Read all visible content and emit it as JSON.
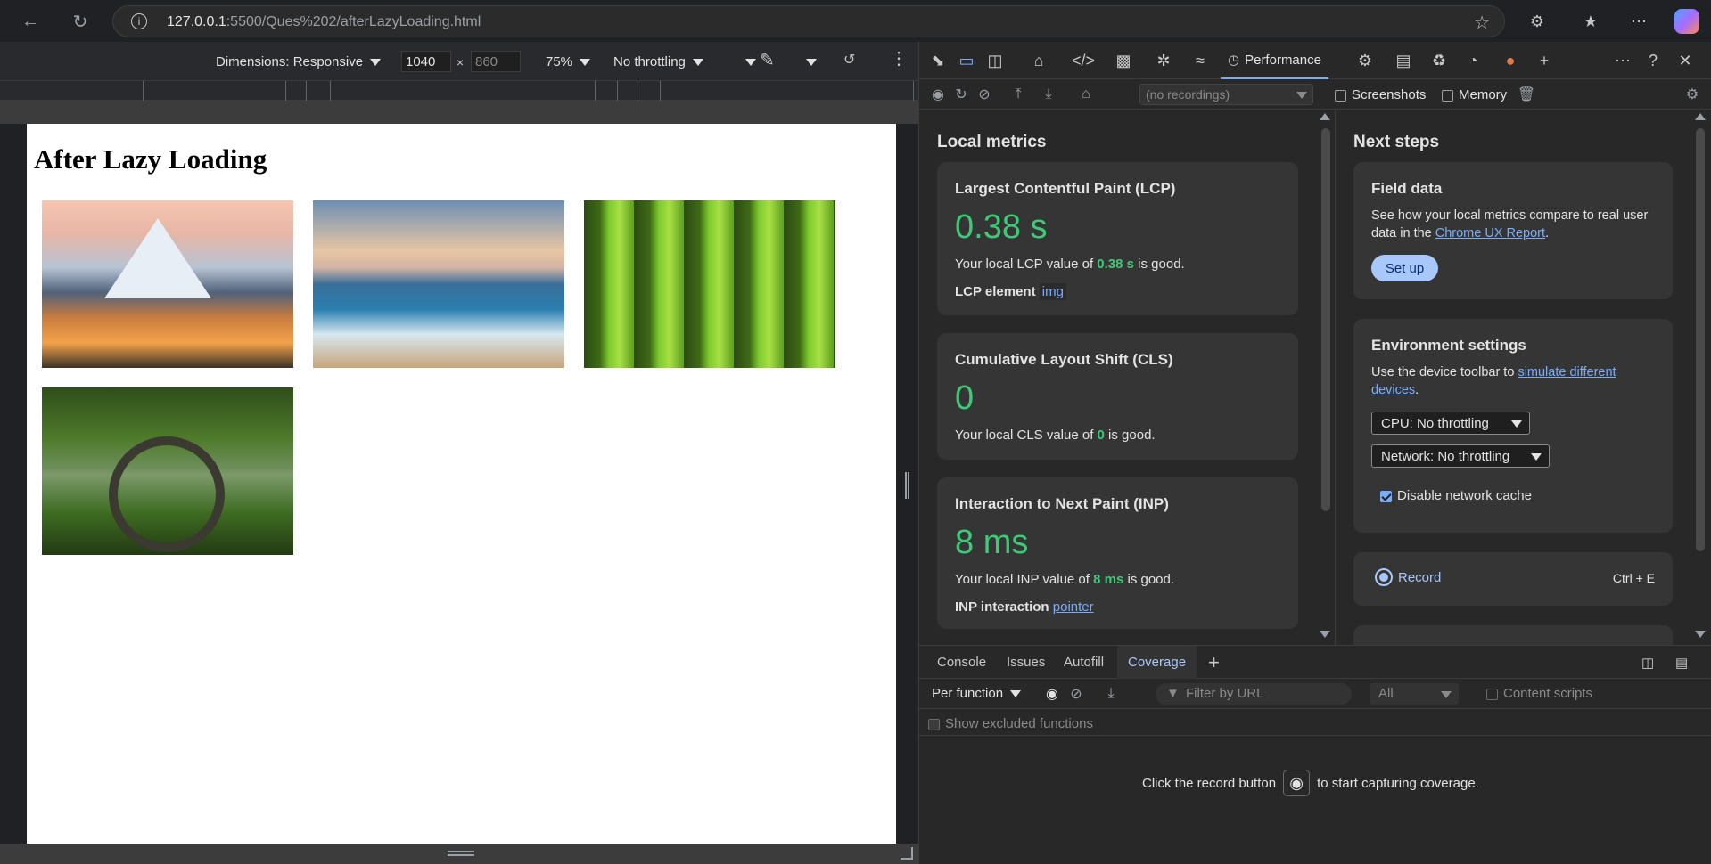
{
  "browser": {
    "url_host": "127.0.0.1",
    "url_rest": ":5500/Ques%202/afterLazyLoading.html"
  },
  "device_toolbar": {
    "dimensions_label": "Dimensions: Responsive",
    "width_value": "1040",
    "height_value": "860",
    "zoom": "75%",
    "throttling": "No throttling"
  },
  "page": {
    "title": "After Lazy Loading",
    "images": [
      "mountain-lake",
      "ocean-sunset",
      "forest",
      "stone-bridge-lake"
    ]
  },
  "devtools": {
    "active_tab": "Performance",
    "recordings_placeholder": "(no recordings)",
    "screenshots_label": "Screenshots",
    "memory_label": "Memory",
    "local_metrics": {
      "heading": "Local metrics",
      "lcp": {
        "title": "Largest Contentful Paint (LCP)",
        "value": "0.38 s",
        "desc_pre": "Your local LCP value of ",
        "desc_val": "0.38 s",
        "desc_post": " is good.",
        "element_label": "LCP element",
        "element_value": "img"
      },
      "cls": {
        "title": "Cumulative Layout Shift (CLS)",
        "value": "0",
        "desc_pre": "Your local CLS value of ",
        "desc_val": "0",
        "desc_post": " is good."
      },
      "inp": {
        "title": "Interaction to Next Paint (INP)",
        "value": "8 ms",
        "desc_pre": "Your local INP value of ",
        "desc_val": "8 ms",
        "desc_post": " is good.",
        "interaction_label": "INP interaction",
        "interaction_value": "pointer"
      }
    },
    "next_steps": {
      "heading": "Next steps",
      "field_data": {
        "title": "Field data",
        "desc_pre": "See how your local metrics compare to real user data in the ",
        "link": "Chrome UX Report",
        "desc_post": ".",
        "button": "Set up"
      },
      "environment": {
        "title": "Environment settings",
        "desc_pre": "Use the device toolbar to ",
        "link": "simulate different devices",
        "desc_post": ".",
        "cpu": "CPU: No throttling",
        "network": "Network: No throttling",
        "cache_label": "Disable network cache"
      },
      "record": {
        "label": "Record",
        "shortcut": "Ctrl + E"
      }
    },
    "drawer": {
      "tabs": [
        "Console",
        "Issues",
        "Autofill",
        "Coverage"
      ],
      "active_tab": "Coverage",
      "mode": "Per function",
      "filter_placeholder": "Filter by URL",
      "type_filter": "All",
      "content_scripts_label": "Content scripts",
      "show_excluded_label": "Show excluded functions",
      "empty_pre": "Click the record button",
      "empty_post": "to start capturing coverage."
    }
  },
  "colors": {
    "good": "#3fc977",
    "link": "#7cacf8",
    "accent": "#a8c7fa"
  }
}
